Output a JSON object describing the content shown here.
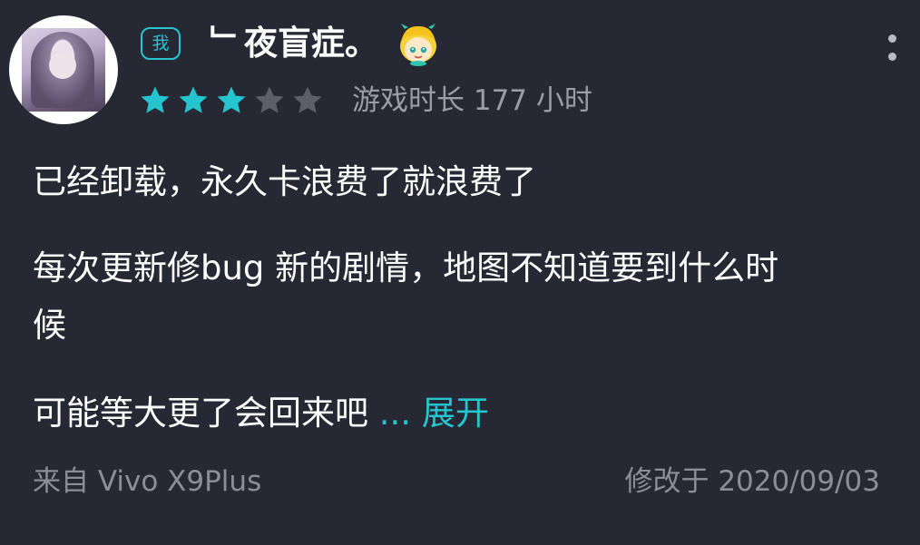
{
  "review": {
    "me_badge": "我",
    "username": "﹂夜盲症。",
    "user_emoji_icon": "cartoon-face-icon",
    "rating": 3,
    "rating_max": 5,
    "playtime": "游戏时长 177 小时",
    "lines": [
      "已经卸载，永久卡浪费了就浪费了",
      "每次更新修bug 新的剧情，地图不知道要到什么时",
      "候",
      "可能等大更了会回来吧"
    ],
    "ellipsis": "...",
    "expand_label": "展开",
    "device": "来自 Vivo X9Plus",
    "modified": "修改于 2020/09/03"
  },
  "colors": {
    "background": "#262833",
    "accent": "#25c5cf",
    "star_filled": "#25c5cf",
    "star_empty": "#5c5e68",
    "secondary_text": "#9a9ca6"
  },
  "icons": {
    "more": "more-vertical-icon",
    "star": "star-icon"
  }
}
